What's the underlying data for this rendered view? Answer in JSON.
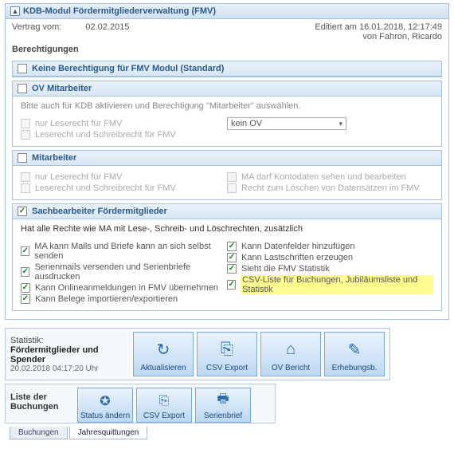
{
  "header": {
    "title": "KDB-Modul Fördermitgliederverwaltung (FMV)",
    "vertrag_label": "Vertrag vom:",
    "vertrag_date": "02.02.2015",
    "edited_line1": "Editiert am 16.01.2018, 12:17:49",
    "edited_line2": "von Fahron, Ricardo",
    "berechtigungen": "Berechtigungen"
  },
  "sections": {
    "none": {
      "title": "Keine Berechtigung für FMV Modul (Standard)"
    },
    "ov": {
      "title": "OV Mitarbeiter",
      "hint": "Bitte auch für KDB aktivieren und Berechtigung \"Mitarbeiter\" auswählen.",
      "read": "nur Leserecht für FMV",
      "rw": "Leserecht und Schreibrecht für FMV",
      "select_value": "kein OV"
    },
    "ma": {
      "title": "Mitarbeiter",
      "read": "nur Leserecht für FMV",
      "rw": "Leserecht und Schreibrecht für FMV",
      "konto": "MA darf Kontodaten sehen und bearbeiten",
      "delete": "Recht zum Löschen von Datensätzen im FMV"
    },
    "sb": {
      "title": "Sachbearbeiter Fördermitglieder",
      "hint": "Hat alle Rechte wie MA mit Lese-, Schreib- und Löschrechten, zusätzlich",
      "c1": "MA kann Mails und Briefe kann an sich selbst senden",
      "c2": "Serienmails versenden und Serienbriefe ausdrucken",
      "c3": "Kann Onlineanmeldungen in FMV übernehmen",
      "c4": "Kann Belege importieren/exportieren",
      "c5": "Kann Datenfelder hinzufügen",
      "c6": "Kann Lastschriften erzeugen",
      "c7": "Sieht die FMV Statistik",
      "c8": "CSV-Liste für Buchungen, Jubiläumsliste und Statistik"
    }
  },
  "statbar": {
    "label": "Statistik:",
    "title": "Fördermitglieder und Spender",
    "ts": "20.02.2018 04:17:20 Uhr",
    "btn_refresh": "Aktualisieren",
    "btn_csv": "CSV Export",
    "btn_ov": "OV Bericht",
    "btn_erh": "Erhebungsb."
  },
  "listbar": {
    "title": "Liste der Buchungen",
    "btn_status": "Status ändern",
    "btn_csv": "CSV Export",
    "btn_serien": "Serienbrief",
    "tab1": "Buchungen",
    "tab2": "Jahresquittungen"
  }
}
